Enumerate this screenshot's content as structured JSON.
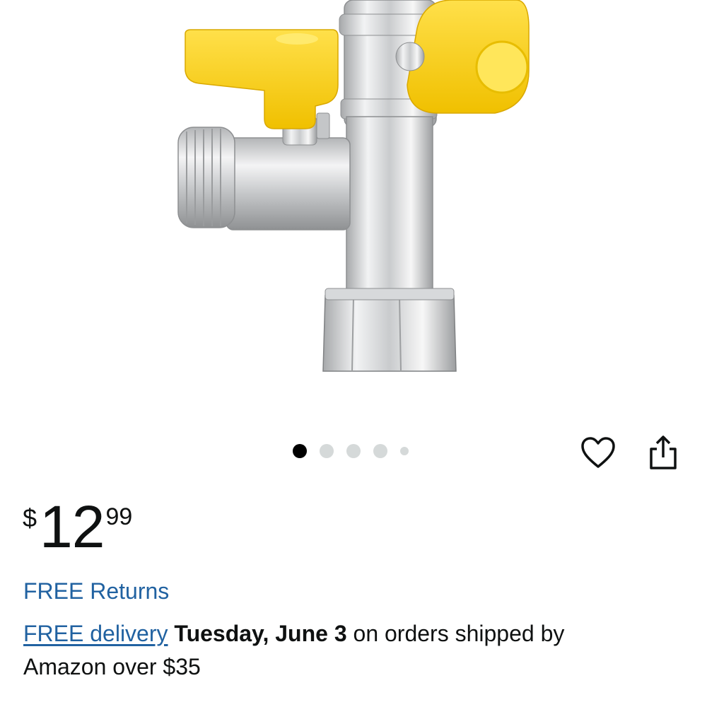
{
  "product": {
    "image_icon": "angle-valve-tee-adapter-image"
  },
  "carousel": {
    "dot_count": 5,
    "active_index": 0
  },
  "actions": {
    "wishlist_icon": "heart-outline-icon",
    "share_icon": "share-icon"
  },
  "price": {
    "symbol": "$",
    "whole": "12",
    "fraction": "99"
  },
  "returns": {
    "label": "FREE Returns"
  },
  "delivery": {
    "link_label": "FREE delivery",
    "date": "Tuesday, June 3",
    "suffix_line1": "on orders shipped by",
    "suffix_line2": "Amazon over $35"
  },
  "colors": {
    "link": "#2162a1",
    "text": "#0f1111",
    "handle_yellow": "#f7d21e",
    "dot_active": "#000000",
    "dot_inactive": "#d5d9d9"
  }
}
